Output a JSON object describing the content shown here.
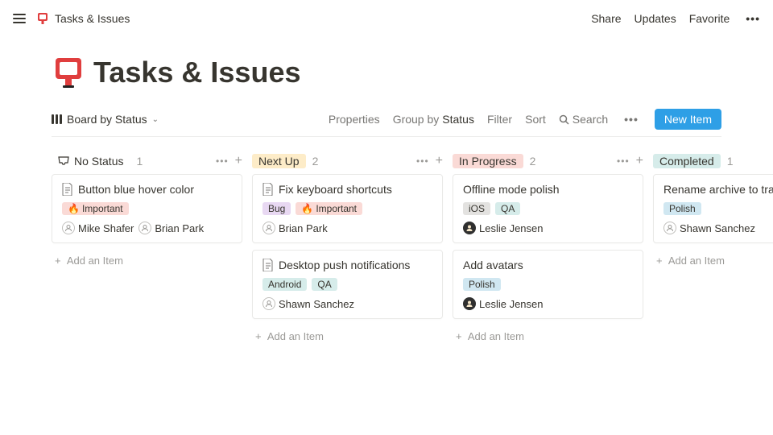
{
  "breadcrumb": {
    "label": "Tasks & Issues"
  },
  "top_actions": {
    "share": "Share",
    "updates": "Updates",
    "favorite": "Favorite"
  },
  "page": {
    "title": "Tasks & Issues"
  },
  "view": {
    "name": "Board by Status",
    "properties": "Properties",
    "group_by_label": "Group by",
    "group_by_value": "Status",
    "filter": "Filter",
    "sort": "Sort",
    "search": "Search",
    "new_item": "New Item"
  },
  "columns": [
    {
      "name": "No Status",
      "count": "1",
      "style": "nostatus",
      "cards": [
        {
          "title": "Button blue hover color",
          "show_doc_icon": true,
          "tags": [
            {
              "label": "Important",
              "style": "important",
              "fire": true
            }
          ],
          "assignees": [
            {
              "name": "Mike Shafer",
              "avatar": "blank"
            },
            {
              "name": "Brian Park",
              "avatar": "blank"
            }
          ]
        }
      ],
      "add_label": "Add an Item"
    },
    {
      "name": "Next Up",
      "count": "2",
      "style": "nextup",
      "cards": [
        {
          "title": "Fix keyboard shortcuts",
          "show_doc_icon": true,
          "tags": [
            {
              "label": "Bug",
              "style": "bug"
            },
            {
              "label": "Important",
              "style": "important",
              "fire": true
            }
          ],
          "assignees": [
            {
              "name": "Brian Park",
              "avatar": "blank"
            }
          ]
        },
        {
          "title": "Desktop push notifications",
          "show_doc_icon": true,
          "tags": [
            {
              "label": "Android",
              "style": "android"
            },
            {
              "label": "QA",
              "style": "qa"
            }
          ],
          "assignees": [
            {
              "name": "Shawn Sanchez",
              "avatar": "blank"
            }
          ]
        }
      ],
      "add_label": "Add an Item"
    },
    {
      "name": "In Progress",
      "count": "2",
      "style": "inprogress",
      "cards": [
        {
          "title": "Offline mode polish",
          "show_doc_icon": false,
          "tags": [
            {
              "label": "iOS",
              "style": "ios"
            },
            {
              "label": "QA",
              "style": "qa"
            }
          ],
          "assignees": [
            {
              "name": "Leslie Jensen",
              "avatar": "dark"
            }
          ]
        },
        {
          "title": "Add avatars",
          "show_doc_icon": false,
          "tags": [
            {
              "label": "Polish",
              "style": "polish"
            }
          ],
          "assignees": [
            {
              "name": "Leslie Jensen",
              "avatar": "dark"
            }
          ]
        }
      ],
      "add_label": "Add an Item"
    },
    {
      "name": "Completed",
      "count": "1",
      "style": "completed",
      "cards": [
        {
          "title": "Rename archive to trash",
          "show_doc_icon": false,
          "tags": [
            {
              "label": "Polish",
              "style": "polish"
            }
          ],
          "assignees": [
            {
              "name": "Shawn Sanchez",
              "avatar": "blank"
            }
          ]
        }
      ],
      "add_label": "Add an Item"
    }
  ]
}
